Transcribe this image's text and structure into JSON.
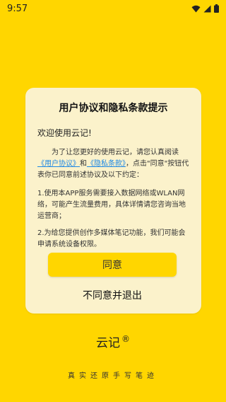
{
  "status_bar": {
    "time": "9:57",
    "icons": [
      "wifi-icon",
      "signal-icon",
      "battery-icon"
    ]
  },
  "dialog": {
    "title": "用户协议和隐私条款提示",
    "greeting": "欢迎使用云记!",
    "intro_1": "为了让您更好的使用云记，请您认真阅读",
    "link_user_agreement": "《用户协议》",
    "intro_and": "和",
    "link_privacy": "《隐私条款》",
    "intro_2": "，点击\"同意\"按钮代表你已同意前述协议及以下约定：",
    "item_1": "1.使用本APP服务需要接入数据网络或WLAN网络，可能产生流量费用，具体详情请您咨询当地运营商；",
    "item_2": "2.为给您提供创作多媒体笔记功能，我们可能会申请系统设备权限。",
    "agree_label": "同意",
    "disagree_label": "不同意并退出"
  },
  "brand": {
    "name": "云记",
    "mark": "®",
    "slogan": "真实还原手写笔迹"
  },
  "colors": {
    "background": "#FFD600",
    "dialog_bg": "#FBF2CB",
    "button": "#FFD600",
    "link": "#1E88E5"
  }
}
